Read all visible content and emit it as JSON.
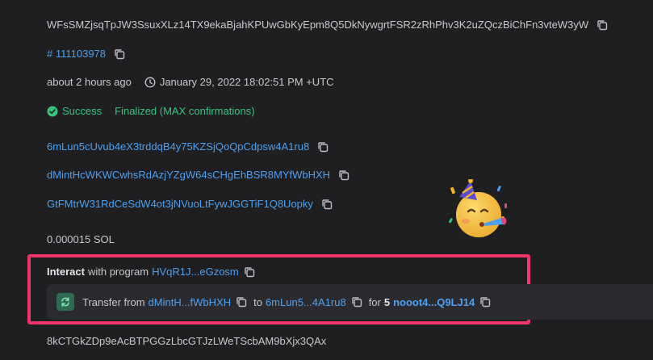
{
  "signature": "WFsSMZjsqTpJW3SsuxXLz14TX9ekaBjahKPUwGbKyEpm8Q5DkNywgrtFSR2zRhPhv3K2uZQczBiChFn3vteW3yW",
  "block": "# 111103978",
  "time": {
    "relative": "about 2 hours ago",
    "absolute": "January 29, 2022 18:02:51 PM +UTC"
  },
  "status": {
    "label": "Success",
    "finality": "Finalized (MAX confirmations)"
  },
  "accounts": [
    "6mLun5cUvub4eX3trddqB4y75KZSjQoQpCdpsw4A1ru8",
    "dMintHcWKWCwhsRdAzjYZgW64sCHgEhBSR8MYfWbHXH",
    "GtFMtrW31RdCeSdW4ot3jNVuoLtFywJGGTiF1Q8Uopky"
  ],
  "fee": "0.000015 SOL",
  "interact": {
    "prefix": "Interact",
    "middle": "with program",
    "program": "HVqR1J...eGzosm"
  },
  "transfer": {
    "label": "Transfer from",
    "from": "dMintH...fWbHXH",
    "to_label": "to",
    "to": "6mLun5...4A1ru8",
    "for_label": "for",
    "amount": "5",
    "token": "nooot4...Q9LJ14"
  },
  "next_row": "8kCTGkZDp9eAcBTPGGzLbcGTJzLWeTScbAM9bXjx3QAx",
  "colors": {
    "link": "#4da1f0",
    "success": "#36c47d",
    "highlight": "#f0356d",
    "background": "#1f1f22"
  },
  "icons": [
    "copy-icon",
    "clock-icon",
    "check-circle-icon",
    "swap-icon",
    "partying-face-emoji"
  ]
}
